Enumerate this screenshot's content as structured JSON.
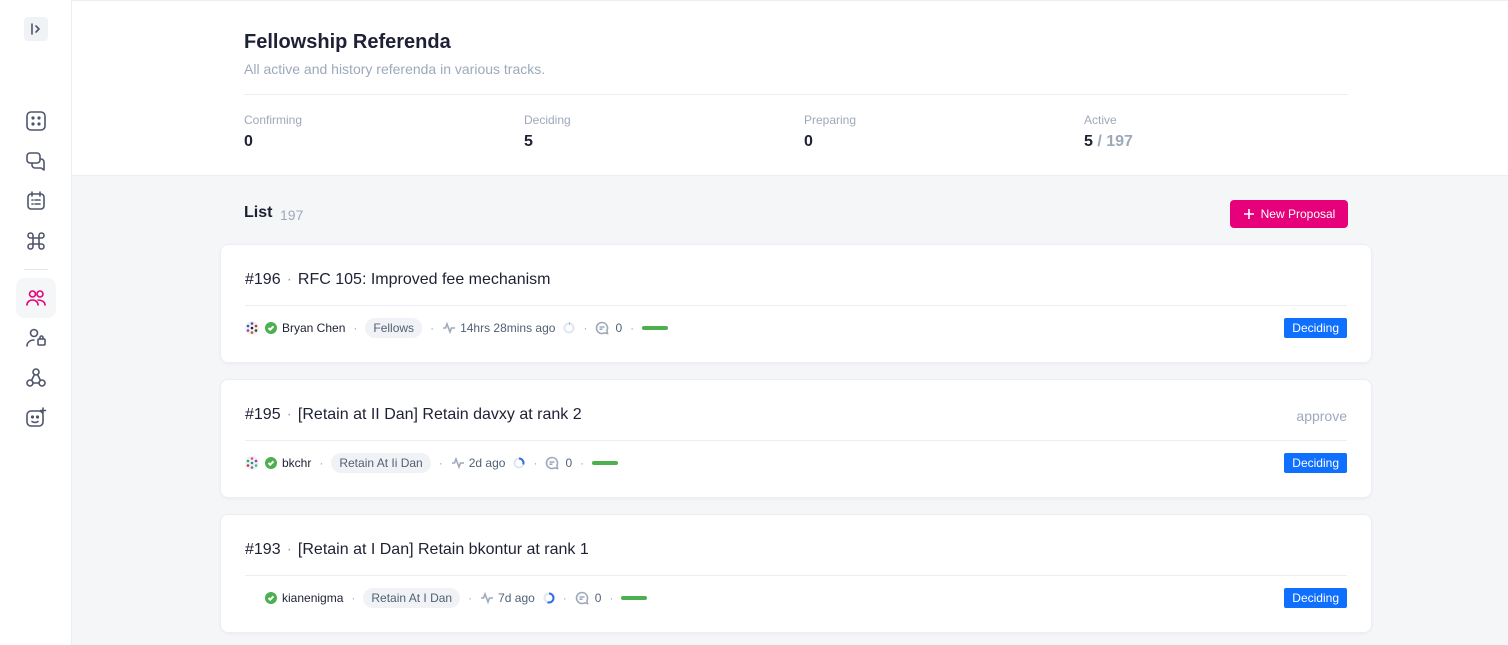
{
  "header": {
    "title": "Fellowship Referenda",
    "description": "All active and history referenda in various tracks."
  },
  "stats": [
    {
      "label": "Confirming",
      "value": "0"
    },
    {
      "label": "Deciding",
      "value": "5"
    },
    {
      "label": "Preparing",
      "value": "0"
    },
    {
      "label": "Active",
      "value": "5",
      "total": "/ 197"
    }
  ],
  "list": {
    "title": "List",
    "count": "197",
    "new_button_label": "New Proposal"
  },
  "referenda": [
    {
      "index": "#196",
      "title": "RFC 105: Improved fee mechanism",
      "result": "",
      "author": "Bryan Chen",
      "track": "Fellows",
      "time": "14hrs 28mins ago",
      "comments": "0",
      "status": "Deciding",
      "progress": 0.02
    },
    {
      "index": "#195",
      "title": "[Retain at II Dan] Retain davxy at rank 2",
      "result": "approve",
      "author": "bkchr",
      "track": "Retain At Ii Dan",
      "time": "2d ago",
      "comments": "0",
      "status": "Deciding",
      "progress": 0.3
    },
    {
      "index": "#193",
      "title": "[Retain at I Dan] Retain bkontur at rank 1",
      "result": "",
      "author": "kianenigma",
      "track": "Retain At I Dan",
      "time": "7d ago",
      "comments": "0",
      "status": "Deciding",
      "progress": 0.55
    }
  ],
  "colors": {
    "accent": "#e6007a",
    "status_deciding": "#0f6fff",
    "approve_bar": "#4caf50"
  }
}
